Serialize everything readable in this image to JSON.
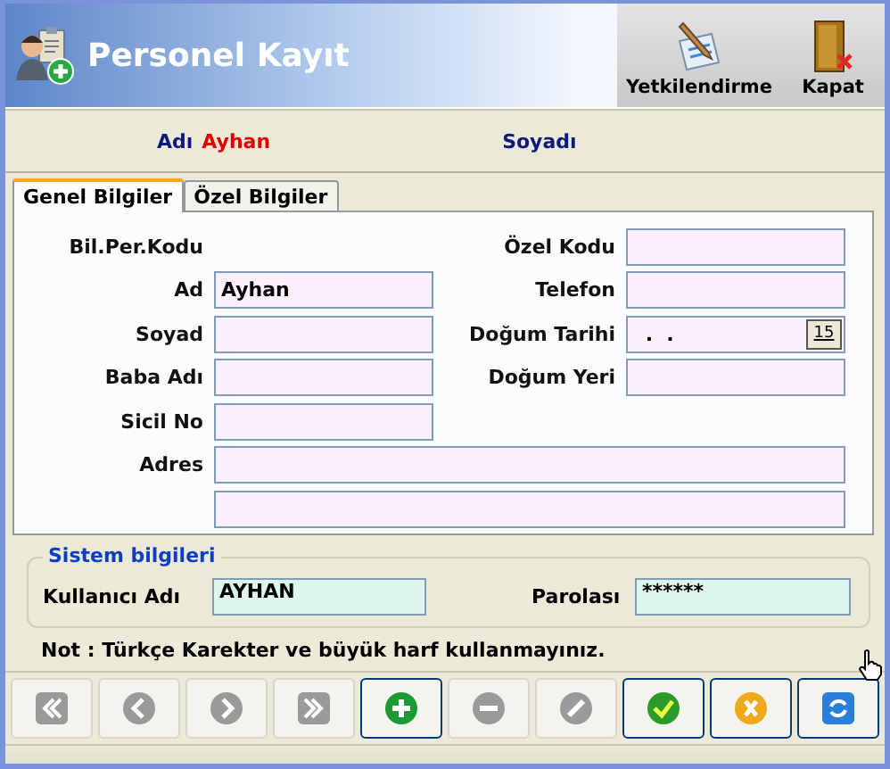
{
  "window": {
    "title": "Personel Kayıt"
  },
  "header_buttons": [
    {
      "label": "Yetkilendirme",
      "kind": "permissions"
    },
    {
      "label": "Kapat",
      "kind": "close"
    }
  ],
  "summary": [
    {
      "label": "Adı",
      "value": "Ayhan"
    },
    {
      "label": "Soyadı"
    }
  ],
  "tabs": [
    {
      "label": "Genel Bilgiler",
      "selected": true
    },
    {
      "label": "Özel Bilgiler",
      "selected": false
    }
  ],
  "form": {
    "left": [
      {
        "label": "Bil.Per.Kodu",
        "kind": "text"
      },
      {
        "label": "Ad",
        "kind": "field",
        "value": "Ayhan"
      },
      {
        "label": "Soyad",
        "kind": "field"
      },
      {
        "label": "Baba Adı",
        "kind": "field"
      },
      {
        "label": "Sicil No",
        "kind": "field"
      }
    ],
    "right": [
      {
        "label": "Özel Kodu",
        "kind": "field"
      },
      {
        "label": "Telefon",
        "kind": "field"
      },
      {
        "label": "Doğum Tarihi",
        "kind": "date",
        "value": " .  .",
        "button": "15"
      },
      {
        "label": "Doğum Yeri",
        "kind": "field"
      }
    ],
    "address_label": "Adres"
  },
  "system": {
    "title": "Sistem bilgileri",
    "username_label": "Kullanıcı Adı",
    "username": "AYHAN",
    "password_label": "Parolası",
    "password": "******"
  },
  "note": "Not : Türkçe Karekter ve büyük harf kullanmayınız.",
  "toolbar": [
    {
      "kind": "first",
      "disabled": true
    },
    {
      "kind": "previous",
      "disabled": true
    },
    {
      "kind": "next",
      "disabled": true
    },
    {
      "kind": "last",
      "disabled": true
    },
    {
      "kind": "add",
      "disabled": false
    },
    {
      "kind": "delete",
      "disabled": true
    },
    {
      "kind": "edit",
      "disabled": true
    },
    {
      "kind": "save",
      "disabled": false
    },
    {
      "kind": "cancel",
      "disabled": false
    },
    {
      "kind": "refresh",
      "disabled": false
    }
  ]
}
